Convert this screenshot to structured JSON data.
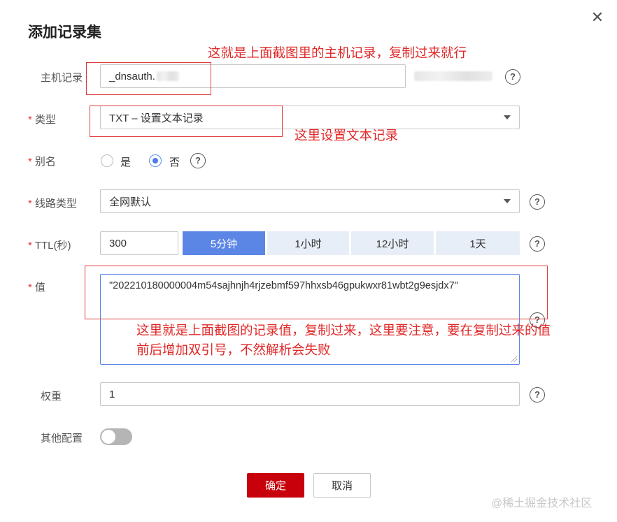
{
  "dialog": {
    "title": "添加记录集"
  },
  "fields": {
    "host": {
      "label": "主机记录",
      "value": "_dnsauth."
    },
    "type": {
      "label": "类型",
      "value": "TXT – 设置文本记录"
    },
    "alias": {
      "label": "别名",
      "yes": "是",
      "no": "否",
      "selected": "否"
    },
    "line": {
      "label": "线路类型",
      "value": "全网默认"
    },
    "ttl": {
      "label": "TTL(秒)",
      "value": "300",
      "options": [
        "5分钟",
        "1小时",
        "12小时",
        "1天"
      ],
      "active": "5分钟"
    },
    "value": {
      "label": "值",
      "value": "\"202210180000004m54sajhnjh4rjzebmf597hhxsb46gpukwxr81wbt2g9esjdx7\""
    },
    "weight": {
      "label": "权重",
      "value": "1"
    },
    "other": {
      "label": "其他配置",
      "enabled": false
    }
  },
  "required_mark": "*",
  "help_glyph": "?",
  "buttons": {
    "ok": "确定",
    "cancel": "取消"
  },
  "annotations": {
    "host_note": "这就是上面截图里的主机记录，复制过来就行",
    "type_note": "这里设置文本记录",
    "value_note_line1": "这里就是上面截图的记录值，复制过来，这里要注意，要在复制过来的值",
    "value_note_line2": "前后增加双引号，不然解析会失败"
  },
  "watermark": "@稀土掘金技术社区",
  "colors": {
    "primary": "#c7000b",
    "accent": "#5b86e5",
    "annotation": "#e02828"
  }
}
